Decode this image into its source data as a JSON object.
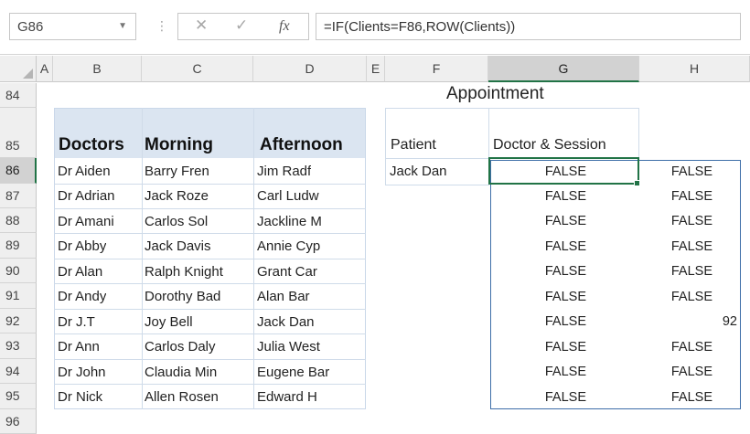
{
  "formula_bar": {
    "name_box": "G86",
    "separator": "⋮",
    "cancel": "✕",
    "enter": "✓",
    "fx": "fx",
    "formula": "=IF(Clients=F86,ROW(Clients))"
  },
  "columns": [
    "A",
    "B",
    "C",
    "D",
    "E",
    "F",
    "G",
    "H"
  ],
  "rows": [
    "84",
    "85",
    "86",
    "87",
    "88",
    "89",
    "90",
    "91",
    "92",
    "93",
    "94",
    "95",
    "96"
  ],
  "selected_cell": "G86",
  "title": "Appointment",
  "table": {
    "headers": [
      "Doctors",
      "Morning",
      "Afternoon"
    ],
    "rows": [
      [
        "Dr Aiden",
        "Barry Fren",
        "Jim Radf"
      ],
      [
        "Dr Adrian",
        "Jack Roze",
        "Carl Ludw"
      ],
      [
        "Dr Amani",
        "Carlos Sol",
        "Jackline M"
      ],
      [
        "Dr Abby",
        "Jack Davis",
        "Annie Cyp"
      ],
      [
        "Dr Alan",
        "Ralph Knight",
        "Grant Car"
      ],
      [
        "Dr Andy",
        "Dorothy Bad",
        "Alan Bar"
      ],
      [
        "Dr J.T",
        "Joy Bell",
        "Jack Dan"
      ],
      [
        "Dr Ann",
        "Carlos Daly",
        "Julia West"
      ],
      [
        "Dr John",
        "Claudia Min",
        "Eugene Bar"
      ],
      [
        "Dr Nick",
        "Allen Rosen",
        "Edward H"
      ]
    ]
  },
  "lookup": {
    "patient_header": "Patient",
    "doctor_header": "Doctor & Session",
    "patient_value": "Jack Dan"
  },
  "results": {
    "G": [
      "FALSE",
      "FALSE",
      "FALSE",
      "FALSE",
      "FALSE",
      "FALSE",
      "FALSE",
      "FALSE",
      "FALSE",
      "FALSE"
    ],
    "H": [
      "FALSE",
      "FALSE",
      "FALSE",
      "FALSE",
      "FALSE",
      "FALSE",
      "92",
      "FALSE",
      "FALSE",
      "FALSE"
    ]
  }
}
